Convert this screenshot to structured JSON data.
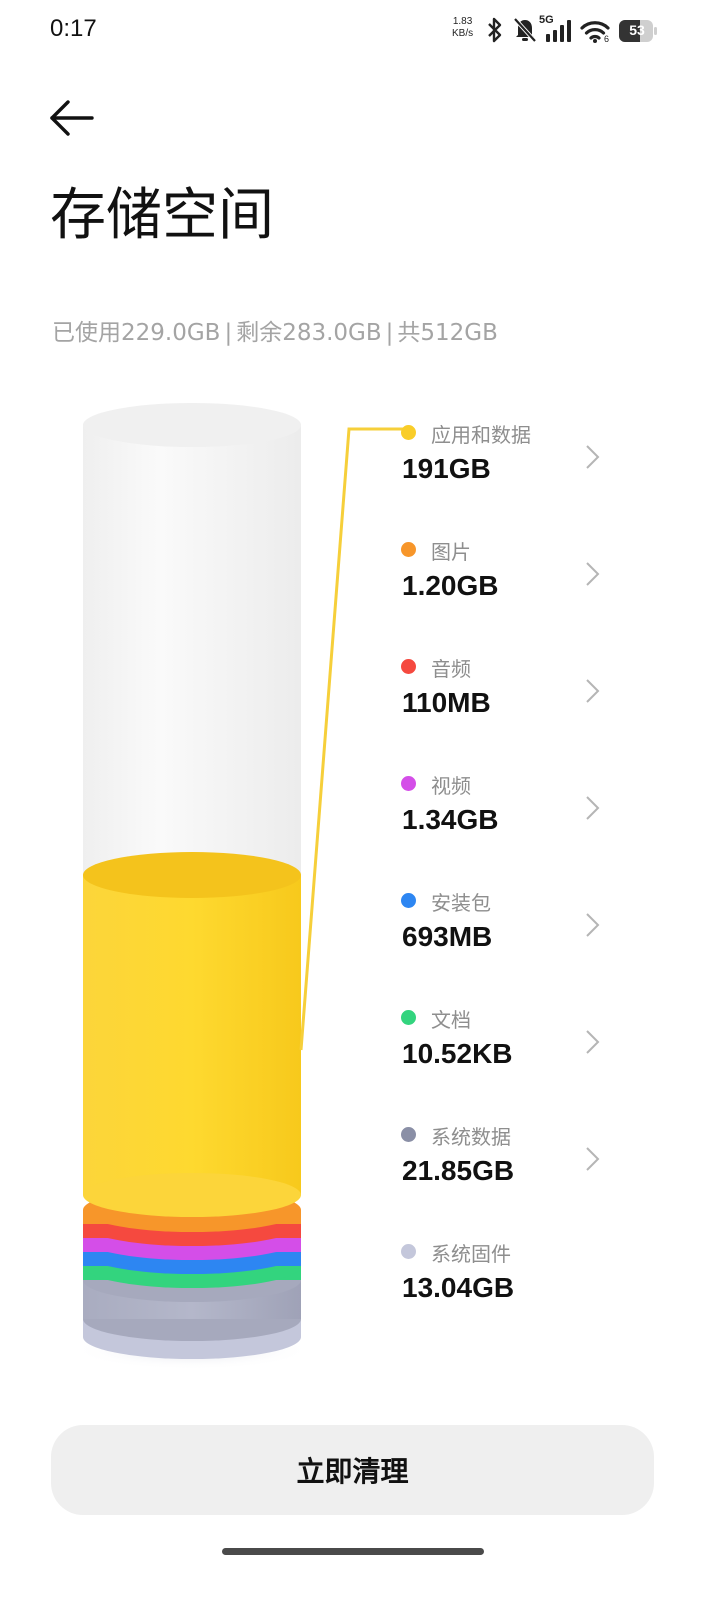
{
  "status_bar": {
    "time": "0:17",
    "net_speed_value": "1.83",
    "net_speed_unit": "KB/s",
    "network_type": "5G",
    "wifi_label": "6",
    "battery": "53"
  },
  "header": {
    "back_icon": "arrow-left-icon",
    "title": "存储空间"
  },
  "summary": {
    "used": "已使用229.0GB",
    "remaining": "剩余283.0GB",
    "total": "共512GB",
    "separator": "|"
  },
  "colors": {
    "apps": "#f9cd29",
    "images": "#f7962a",
    "audio": "#f5493f",
    "video": "#d44ee8",
    "apk": "#2d86f2",
    "docs": "#33d47e",
    "system_data": "#8a8fa6",
    "firmware": "#c4c7db",
    "free": "#f4f4f4"
  },
  "categories": [
    {
      "key": "apps",
      "label": "应用和数据",
      "value": "191GB",
      "has_arrow": true
    },
    {
      "key": "images",
      "label": "图片",
      "value": "1.20GB",
      "has_arrow": true
    },
    {
      "key": "audio",
      "label": "音频",
      "value": "110MB",
      "has_arrow": true
    },
    {
      "key": "video",
      "label": "视频",
      "value": "1.34GB",
      "has_arrow": true
    },
    {
      "key": "apk",
      "label": "安装包",
      "value": "693MB",
      "has_arrow": true
    },
    {
      "key": "docs",
      "label": "文档",
      "value": "10.52KB",
      "has_arrow": true
    },
    {
      "key": "system_data",
      "label": "系统数据",
      "value": "21.85GB",
      "has_arrow": true
    },
    {
      "key": "firmware",
      "label": "系统固件",
      "value": "13.04GB",
      "has_arrow": false
    }
  ],
  "actions": {
    "clean_label": "立即清理"
  }
}
